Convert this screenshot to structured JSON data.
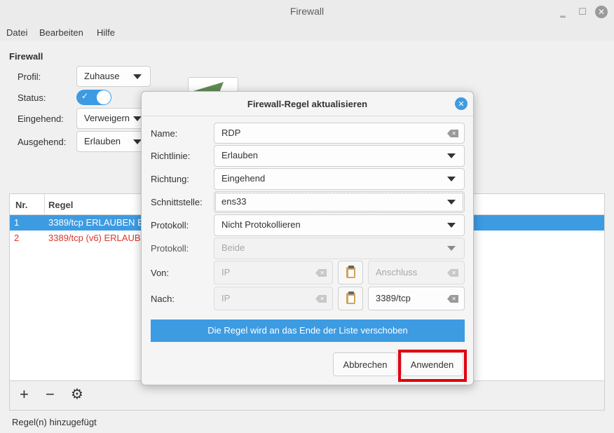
{
  "window": {
    "title": "Firewall"
  },
  "menu": {
    "items": [
      "Datei",
      "Bearbeiten",
      "Hilfe"
    ]
  },
  "main": {
    "heading": "Firewall",
    "profile_label": "Profil:",
    "profile_value": "Zuhause",
    "status_label": "Status:",
    "status_on": true,
    "incoming_label": "Eingehend:",
    "incoming_value": "Verweigern",
    "outgoing_label": "Ausgehend:",
    "outgoing_value": "Erlauben"
  },
  "table": {
    "headers": [
      "Nr.",
      "Regel"
    ],
    "rows": [
      {
        "nr": "1",
        "rule": "3389/tcp ERLAUBEN E"
      },
      {
        "nr": "2",
        "rule": "3389/tcp (v6) ERLAUB"
      }
    ]
  },
  "toolbar": {
    "add": "+",
    "remove": "−",
    "settings": "⚙"
  },
  "statusbar": {
    "text": "Regel(n) hinzugefügt"
  },
  "dialog": {
    "title": "Firewall-Regel aktualisieren",
    "name_label": "Name:",
    "name_value": "RDP",
    "policy_label": "Richtlinie:",
    "policy_value": "Erlauben",
    "direction_label": "Richtung:",
    "direction_value": "Eingehend",
    "interface_label": "Schnittstelle:",
    "interface_value": "ens33",
    "logging_label": "Protokoll:",
    "logging_value": "Nicht Protokollieren",
    "protocol_label": "Protokoll:",
    "protocol_value": "Beide",
    "from_label": "Von:",
    "from_ip_placeholder": "IP",
    "from_port_placeholder": "Anschluss",
    "to_label": "Nach:",
    "to_ip_placeholder": "IP",
    "to_port_value": "3389/tcp",
    "info": "Die Regel wird an das Ende der Liste verschoben",
    "cancel": "Abbrechen",
    "apply": "Anwenden"
  },
  "colors": {
    "accent": "#3d9be2",
    "highlight": "#e0000f",
    "error_row": "#d9372b"
  }
}
